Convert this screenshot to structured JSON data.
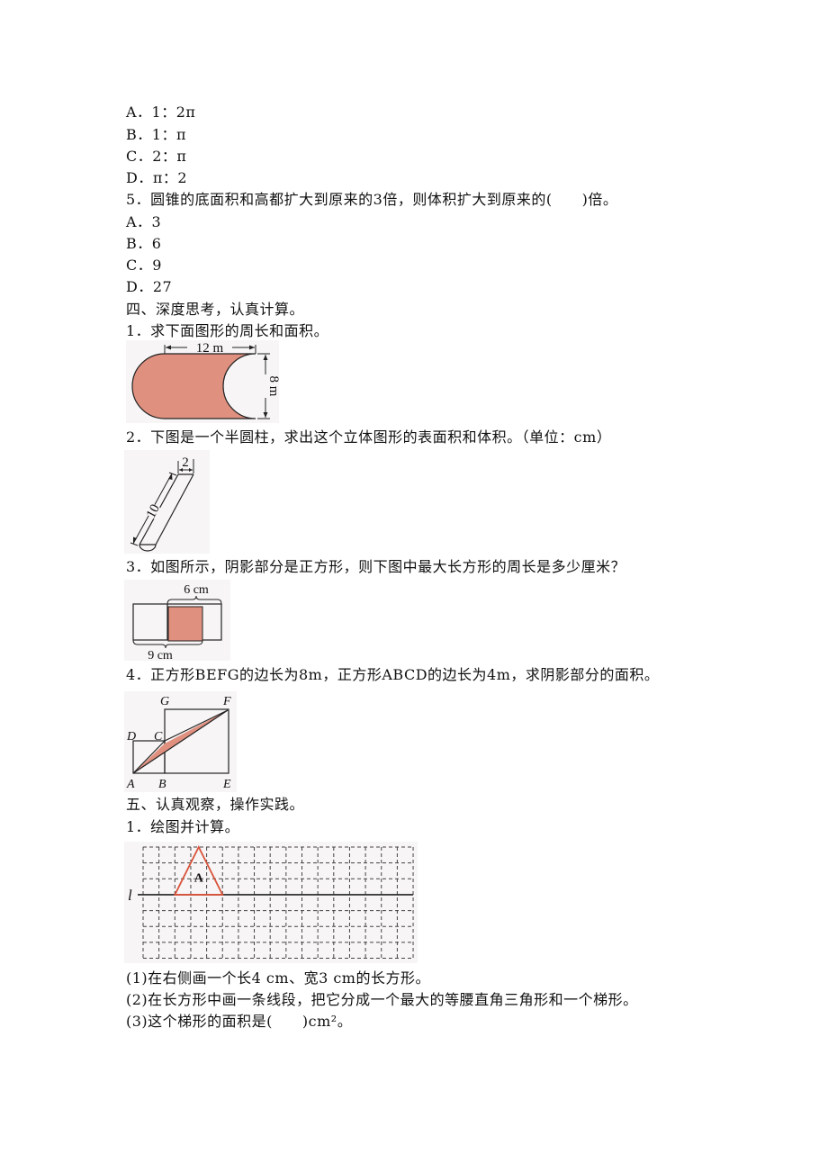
{
  "q4_options": [
    {
      "label": "A．1：2π"
    },
    {
      "label": "B．1：π"
    },
    {
      "label": "C．2：π"
    },
    {
      "label": "D．π：2"
    }
  ],
  "q5": {
    "stem": "5．圆锥的底面积和高都扩大到原来的3倍，则体积扩大到原来的(　　)倍。",
    "options": [
      {
        "label": "A．3"
      },
      {
        "label": "B．6"
      },
      {
        "label": "C．9"
      },
      {
        "label": "D．27"
      }
    ]
  },
  "section4": {
    "heading": "四、深度思考，认真计算。",
    "problems": [
      {
        "text": "1．求下面图形的周长和面积。",
        "figure": {
          "top_length": "12 m",
          "height": "8 m",
          "fill_color": "#E0907F"
        }
      },
      {
        "text": "2．下图是一个半圆柱，求出这个立体图形的表面积和体积。（单位：cm）",
        "figure": {
          "diameter": "2",
          "length": "10"
        }
      },
      {
        "text": "3．如图所示，阴影部分是正方形，则下图中最大长方形的周长是多少厘米？",
        "figure": {
          "top_span": "6 cm",
          "bottom_span": "9 cm",
          "fill_color": "#E0907F"
        }
      },
      {
        "text": "4．正方形BEFG的边长为8m，正方形ABCD的边长为4m，求阴影部分的面积。",
        "figure": {
          "points": [
            "G",
            "F",
            "D",
            "C",
            "A",
            "B",
            "E"
          ],
          "fill_color": "#E0907F"
        }
      }
    ]
  },
  "section5": {
    "heading": "五、认真观察，操作实践。",
    "problems": [
      {
        "text": "1．绘图并计算。",
        "figure": {
          "line_label": "l",
          "shape_label": "A",
          "grid_columns": 17,
          "grid_rows": 7,
          "triangle_color": "#D9533A"
        },
        "subquestions": [
          {
            "text": "(1)在右侧画一个长4 cm、宽3 cm的长方形。"
          },
          {
            "text": "(2)在长方形中画一条线段，把它分成一个最大的等腰直角三角形和一个梯形。"
          },
          {
            "text": "(3)这个梯形的面积是(　　)cm²。"
          }
        ]
      }
    ]
  }
}
